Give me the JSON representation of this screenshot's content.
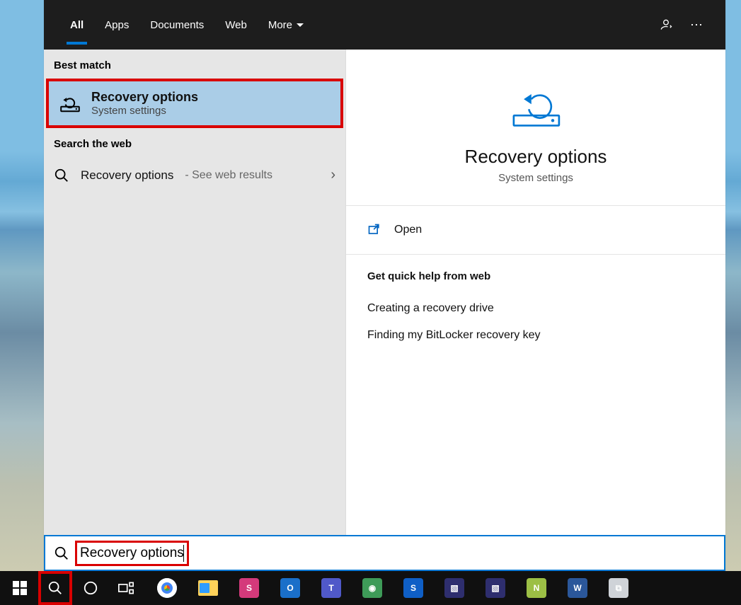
{
  "tabs": {
    "all": "All",
    "apps": "Apps",
    "documents": "Documents",
    "web": "Web",
    "more": "More"
  },
  "left": {
    "best_match_header": "Best match",
    "best_match": {
      "title": "Recovery options",
      "subtitle": "System settings"
    },
    "search_web_header": "Search the web",
    "web_item": {
      "label": "Recovery options",
      "suffix": "- See web results"
    }
  },
  "detail": {
    "title": "Recovery options",
    "subtitle": "System settings",
    "open_label": "Open",
    "links_header": "Get quick help from web",
    "links": [
      "Creating a recovery drive",
      "Finding my BitLocker recovery key"
    ]
  },
  "search": {
    "query": "Recovery options"
  },
  "taskbar": {
    "apps": [
      {
        "name": "chrome"
      },
      {
        "name": "file-explorer"
      },
      {
        "name": "snip",
        "bg": "#d43a7b",
        "label": "S"
      },
      {
        "name": "outlook",
        "bg": "#1a6fc9",
        "label": "O"
      },
      {
        "name": "teams",
        "bg": "#5059c9",
        "label": "T"
      },
      {
        "name": "globe",
        "bg": "#3e9b58",
        "label": "◉"
      },
      {
        "name": "shield",
        "bg": "#0f5fc6",
        "label": "S"
      },
      {
        "name": "remote1",
        "bg": "#2e2e6e",
        "label": "▧"
      },
      {
        "name": "remote2",
        "bg": "#2e2e6e",
        "label": "▧"
      },
      {
        "name": "notepadpp",
        "bg": "#9cbf45",
        "label": "N"
      },
      {
        "name": "word",
        "bg": "#2b579a",
        "label": "W"
      },
      {
        "name": "monitor",
        "bg": "#cfd3d8",
        "label": "⧉"
      }
    ]
  }
}
